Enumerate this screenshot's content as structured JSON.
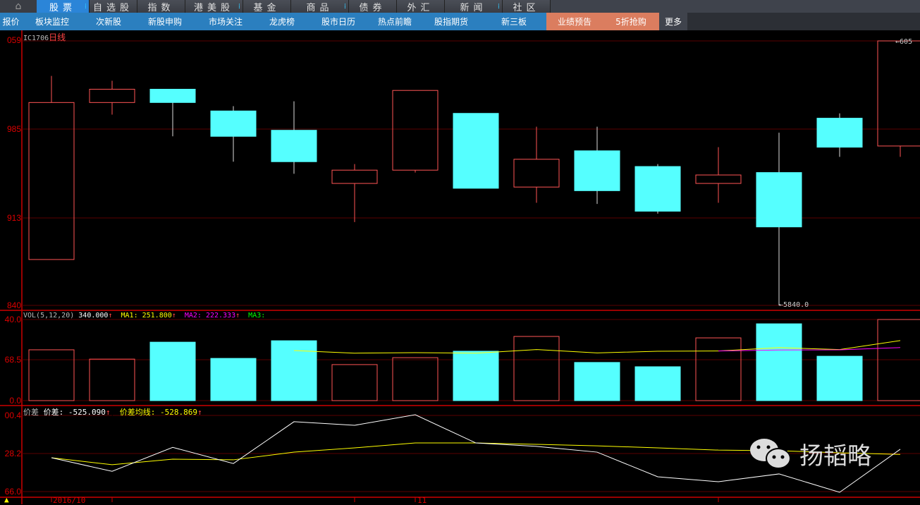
{
  "top_tabs": [
    {
      "label": "股票",
      "active": true,
      "dots": true,
      "w": 75
    },
    {
      "label": "自选股",
      "w": 68
    },
    {
      "label": "指数",
      "w": 68
    },
    {
      "label": "港美股",
      "dots": true,
      "w": 82
    },
    {
      "label": "基金",
      "w": 68
    },
    {
      "label": "商品",
      "dots": true,
      "w": 82
    },
    {
      "label": "债券",
      "w": 68
    },
    {
      "label": "外汇",
      "w": 68
    },
    {
      "label": "新闻",
      "dots": true,
      "w": 82
    },
    {
      "label": "社区",
      "w": 68
    }
  ],
  "nav": [
    {
      "label": "报价",
      "w": 31
    },
    {
      "label": "板块监控",
      "w": 86
    },
    {
      "label": "次新股",
      "w": 74
    },
    {
      "label": "新股申购",
      "w": 86
    },
    {
      "label": "市场关注",
      "w": 86
    },
    {
      "label": "龙虎榜",
      "w": 74
    },
    {
      "label": "股市日历",
      "w": 86
    },
    {
      "label": "热点前瞻",
      "w": 74
    },
    {
      "label": "股指期货",
      "w": 86
    },
    {
      "label": "新三板",
      "w": 92
    },
    {
      "label": "业绩预告",
      "hot": true,
      "w": 80
    },
    {
      "label": "5折抢购",
      "hot": true,
      "w": 80
    },
    {
      "label": "更多",
      "more": true,
      "w": 40
    }
  ],
  "colors": {
    "up": "#ff5555",
    "down": "#55ffff",
    "grid": "#5a0000",
    "axis": "#cc0000",
    "ma1": "#ffff00",
    "ma2": "#ff00ff",
    "ma3": "#00ff00",
    "spread": "#ffffff",
    "spread_ma": "#ffff00"
  },
  "main": {
    "symbol": "IC1706",
    "period": "日线",
    "axis_labels": [
      "059",
      "985",
      "913",
      "840"
    ],
    "high_label": "605",
    "low_label": "5840.0"
  },
  "vol": {
    "title": "VOL(5,12,20)",
    "value": "340.000",
    "ma1": "MA1: 251.800",
    "ma2": "MA2: 222.333",
    "ma3": "MA3:",
    "axis_labels": [
      "40.0",
      "68.5",
      "0.0"
    ]
  },
  "spread": {
    "title": "价差",
    "value_label": "价差: -525.090",
    "ma_label": "价差均线: -528.869",
    "axis_labels": [
      "00.4",
      "28.2",
      "66.0"
    ]
  },
  "x_labels": [
    "2016/10",
    "11"
  ],
  "watermark": "扬韬略",
  "chart_data": [
    {
      "type": "candlestick",
      "ylim": [
        5840,
        6059
      ],
      "candles": [
        {
          "o": 5878,
          "h": 6030,
          "l": 5878,
          "c": 6008
        },
        {
          "o": 6008,
          "h": 6026,
          "l": 5998,
          "c": 6019
        },
        {
          "o": 6019,
          "h": 6019,
          "l": 5980,
          "c": 6008
        },
        {
          "o": 6001,
          "h": 6005,
          "l": 5959,
          "c": 5980
        },
        {
          "o": 5985,
          "h": 6009,
          "l": 5949,
          "c": 5959
        },
        {
          "o": 5941,
          "h": 5957,
          "l": 5909,
          "c": 5952
        },
        {
          "o": 5952,
          "h": 6018,
          "l": 5950,
          "c": 6018
        },
        {
          "o": 5999,
          "h": 5999,
          "l": 5937,
          "c": 5937
        },
        {
          "o": 5938,
          "h": 5988,
          "l": 5925,
          "c": 5961
        },
        {
          "o": 5968,
          "h": 5988,
          "l": 5924,
          "c": 5935
        },
        {
          "o": 5955,
          "h": 5957,
          "l": 5916,
          "c": 5918
        },
        {
          "o": 5941,
          "h": 5971,
          "l": 5925,
          "c": 5948
        },
        {
          "o": 5950,
          "h": 5983,
          "l": 5840,
          "c": 5905
        },
        {
          "o": 5995,
          "h": 5999,
          "l": 5963,
          "c": 5971
        },
        {
          "o": 5972,
          "h": 6059,
          "l": 5963,
          "c": 6059
        }
      ]
    },
    {
      "type": "bar",
      "ylim": [
        0,
        340
      ],
      "values": [
        213,
        174,
        245,
        177,
        251,
        151,
        180,
        207,
        269,
        160,
        142,
        263,
        322,
        186,
        340
      ],
      "ma1": [
        null,
        null,
        null,
        null,
        210,
        199,
        201,
        199,
        214,
        200,
        207,
        208,
        222,
        214,
        251.8
      ],
      "ma2": [
        null,
        null,
        null,
        null,
        null,
        null,
        null,
        null,
        null,
        null,
        null,
        208,
        212,
        213,
        222.3
      ]
    },
    {
      "type": "line",
      "ylim": [
        -556.0,
        -500.4
      ],
      "spread": [
        -531.3,
        -541.2,
        -523.7,
        -535.5,
        -505.0,
        -507.6,
        -499.9,
        -520.5,
        -523.0,
        -527.2,
        -545.2,
        -548.8,
        -543.1,
        -556.5,
        -525.09
      ],
      "spread_ma": [
        -531.3,
        -536.4,
        -532.3,
        -532.8,
        -527.2,
        -524.1,
        -520.5,
        -520.5,
        -521.5,
        -522.6,
        -524.1,
        -525.7,
        -526.2,
        -527.7,
        -528.869
      ]
    }
  ]
}
